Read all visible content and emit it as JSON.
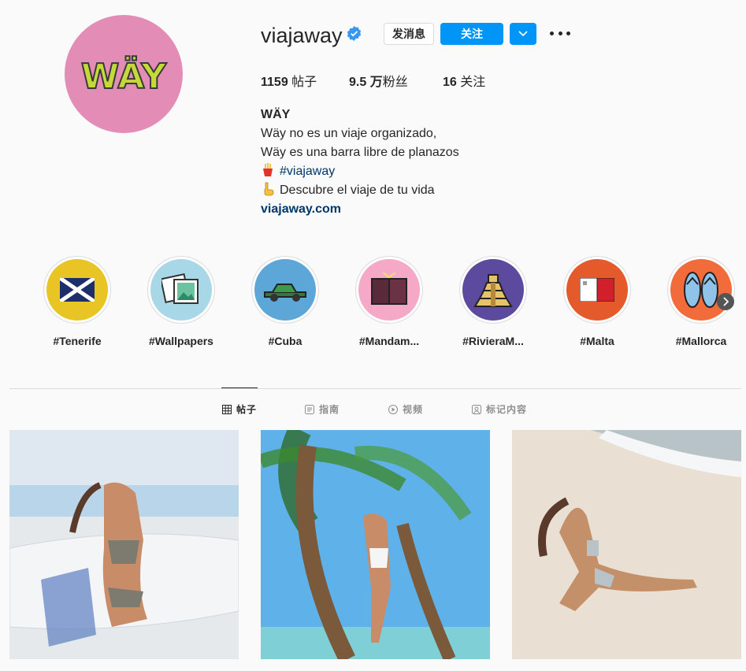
{
  "profile": {
    "username": "viajaway",
    "avatar_text": "WÄY",
    "message_button": "发消息",
    "follow_button": "关注",
    "stats": {
      "posts_value": "1159",
      "posts_label": " 帖子",
      "followers_value": "9.5 万",
      "followers_label": "粉丝",
      "following_value": "16",
      "following_label": " 关注"
    },
    "bio": {
      "name": "WÄY",
      "line1": "Wäy no es un viaje organizado,",
      "line2": "Wäy es una barra libre de planazos",
      "hashtag": "#viajaway",
      "line4": "Descubre el viaje de tu vida",
      "website": "viajaway.com"
    }
  },
  "highlights": [
    {
      "label": "#Tenerife",
      "color": "#e8c524"
    },
    {
      "label": "#Wallpapers",
      "color": "#a8d8e8"
    },
    {
      "label": "#Cuba",
      "color": "#5ca7d8"
    },
    {
      "label": "#Mandam...",
      "color": "#f5a9c7"
    },
    {
      "label": "#RivieraM...",
      "color": "#5b4a9e"
    },
    {
      "label": "#Malta",
      "color": "#e45a2b"
    },
    {
      "label": "#Mallorca",
      "color": "#f26b3a"
    }
  ],
  "tabs": [
    {
      "label": "帖子",
      "icon": "grid-icon"
    },
    {
      "label": "指南",
      "icon": "guide-icon"
    },
    {
      "label": "视频",
      "icon": "play-icon"
    },
    {
      "label": "标记内容",
      "icon": "tagged-icon"
    }
  ]
}
